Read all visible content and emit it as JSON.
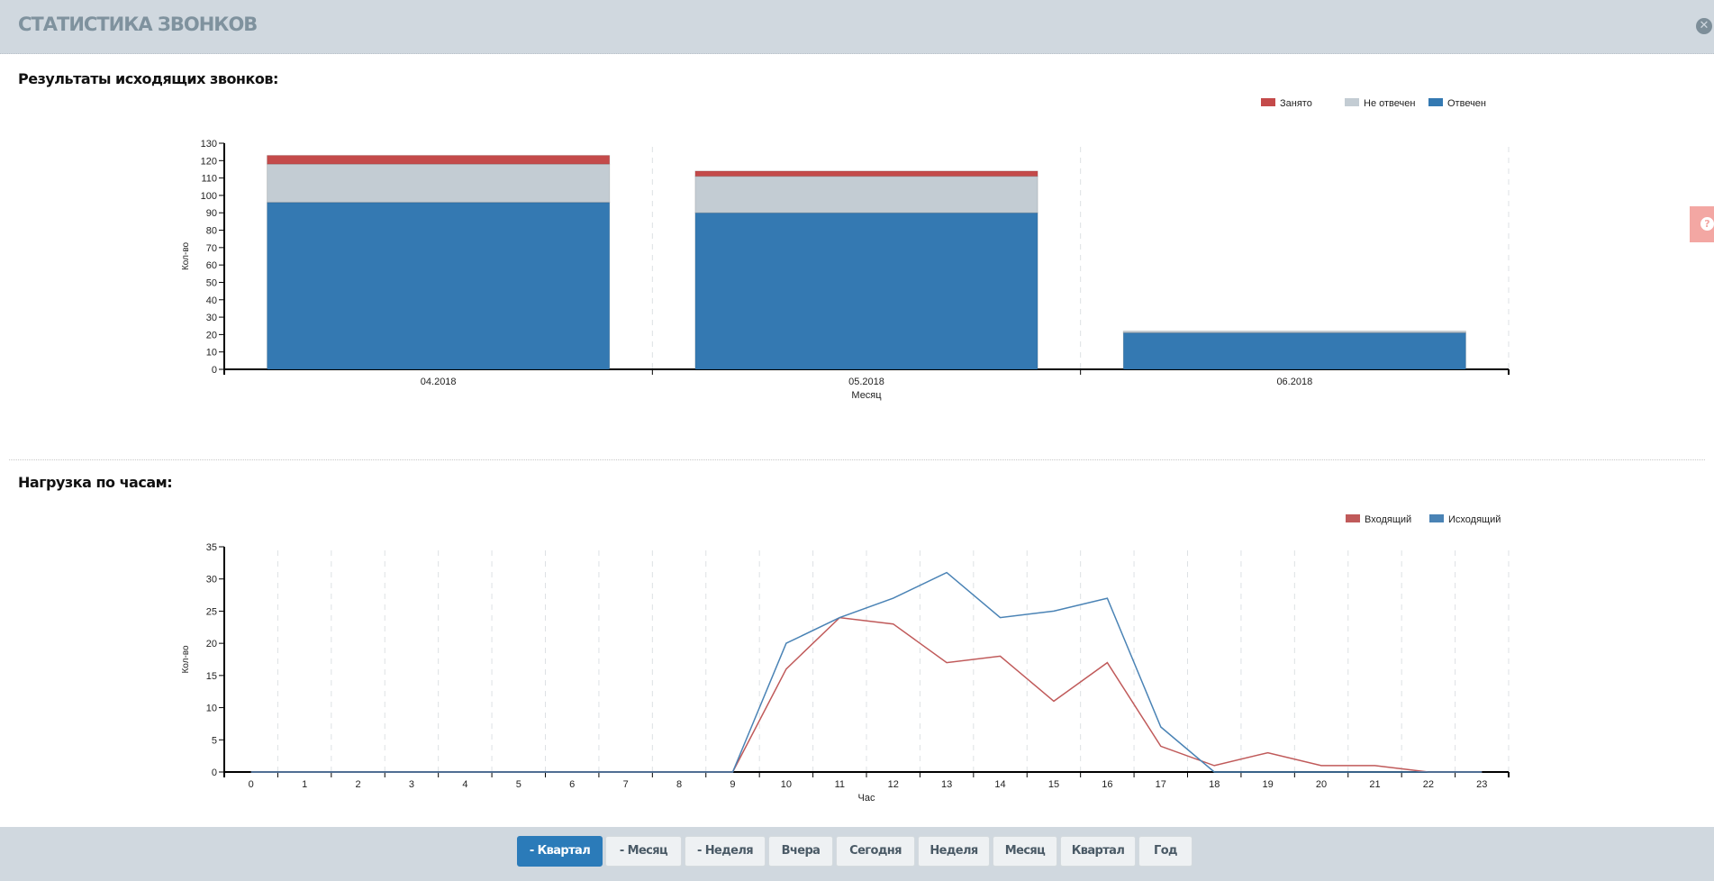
{
  "header": {
    "title": "СТАТИСТИКА ЗВОНКОВ",
    "close_icon": "close-icon"
  },
  "help_tab": {
    "icon": "question-icon",
    "glyph": "?"
  },
  "sections": [
    {
      "title": "Результаты исходящих звонков:"
    },
    {
      "title": "Нагрузка по часам:"
    }
  ],
  "footer": {
    "buttons": [
      {
        "label": "- Квартал",
        "active": true
      },
      {
        "label": "- Месяц",
        "active": false
      },
      {
        "label": "- Неделя",
        "active": false
      },
      {
        "label": "Вчера",
        "active": false
      },
      {
        "label": "Сегодня",
        "active": false
      },
      {
        "label": "Неделя",
        "active": false
      },
      {
        "label": "Месяц",
        "active": false
      },
      {
        "label": "Квартал",
        "active": false
      },
      {
        "label": "Год",
        "active": false
      }
    ]
  },
  "colors": {
    "red": "#c44a4a",
    "gray": "#c3ccd3",
    "blue": "#3479b2",
    "line_red": "#c05a5a",
    "line_blue": "#4a83b5"
  },
  "chart_data": [
    {
      "type": "bar",
      "stacked": true,
      "title": "Результаты исходящих звонков:",
      "xlabel": "Месяц",
      "ylabel": "Кол-во",
      "ylim": [
        0,
        130
      ],
      "yticks": [
        0,
        10,
        20,
        30,
        40,
        50,
        60,
        70,
        80,
        90,
        100,
        110,
        120,
        130
      ],
      "categories": [
        "04.2018",
        "05.2018",
        "06.2018"
      ],
      "legend_position": "top-right",
      "grid": "vertical-dashed",
      "series": [
        {
          "name": "Отвечен",
          "color": "#3479b2",
          "values": [
            96,
            90,
            21
          ]
        },
        {
          "name": "Не отвечен",
          "color": "#c3ccd3",
          "values": [
            22,
            21,
            1
          ]
        },
        {
          "name": "Занято",
          "color": "#c44a4a",
          "values": [
            5,
            3,
            0
          ]
        }
      ],
      "legend": [
        "Занято",
        "Не отвечен",
        "Отвечен"
      ]
    },
    {
      "type": "line",
      "title": "Нагрузка по часам:",
      "xlabel": "Час",
      "ylabel": "Кол-во",
      "ylim": [
        0,
        35
      ],
      "yticks": [
        0,
        5,
        10,
        15,
        20,
        25,
        30,
        35
      ],
      "categories": [
        "0",
        "1",
        "2",
        "3",
        "4",
        "5",
        "6",
        "7",
        "8",
        "9",
        "10",
        "11",
        "12",
        "13",
        "14",
        "15",
        "16",
        "17",
        "18",
        "19",
        "20",
        "21",
        "22",
        "23"
      ],
      "legend_position": "top-right",
      "grid": "vertical-dashed",
      "series": [
        {
          "name": "Входящий",
          "color": "#c05a5a",
          "values": [
            0,
            0,
            0,
            0,
            0,
            0,
            0,
            0,
            0,
            0,
            16,
            24,
            23,
            17,
            18,
            11,
            17,
            4,
            1,
            3,
            1,
            1,
            0,
            0
          ]
        },
        {
          "name": "Исходящий",
          "color": "#4a83b5",
          "values": [
            0,
            0,
            0,
            0,
            0,
            0,
            0,
            0,
            0,
            0,
            20,
            24,
            27,
            31,
            24,
            25,
            27,
            7,
            0,
            0,
            0,
            0,
            0,
            0
          ]
        }
      ],
      "legend": [
        "Входящий",
        "Исходящий"
      ]
    }
  ]
}
